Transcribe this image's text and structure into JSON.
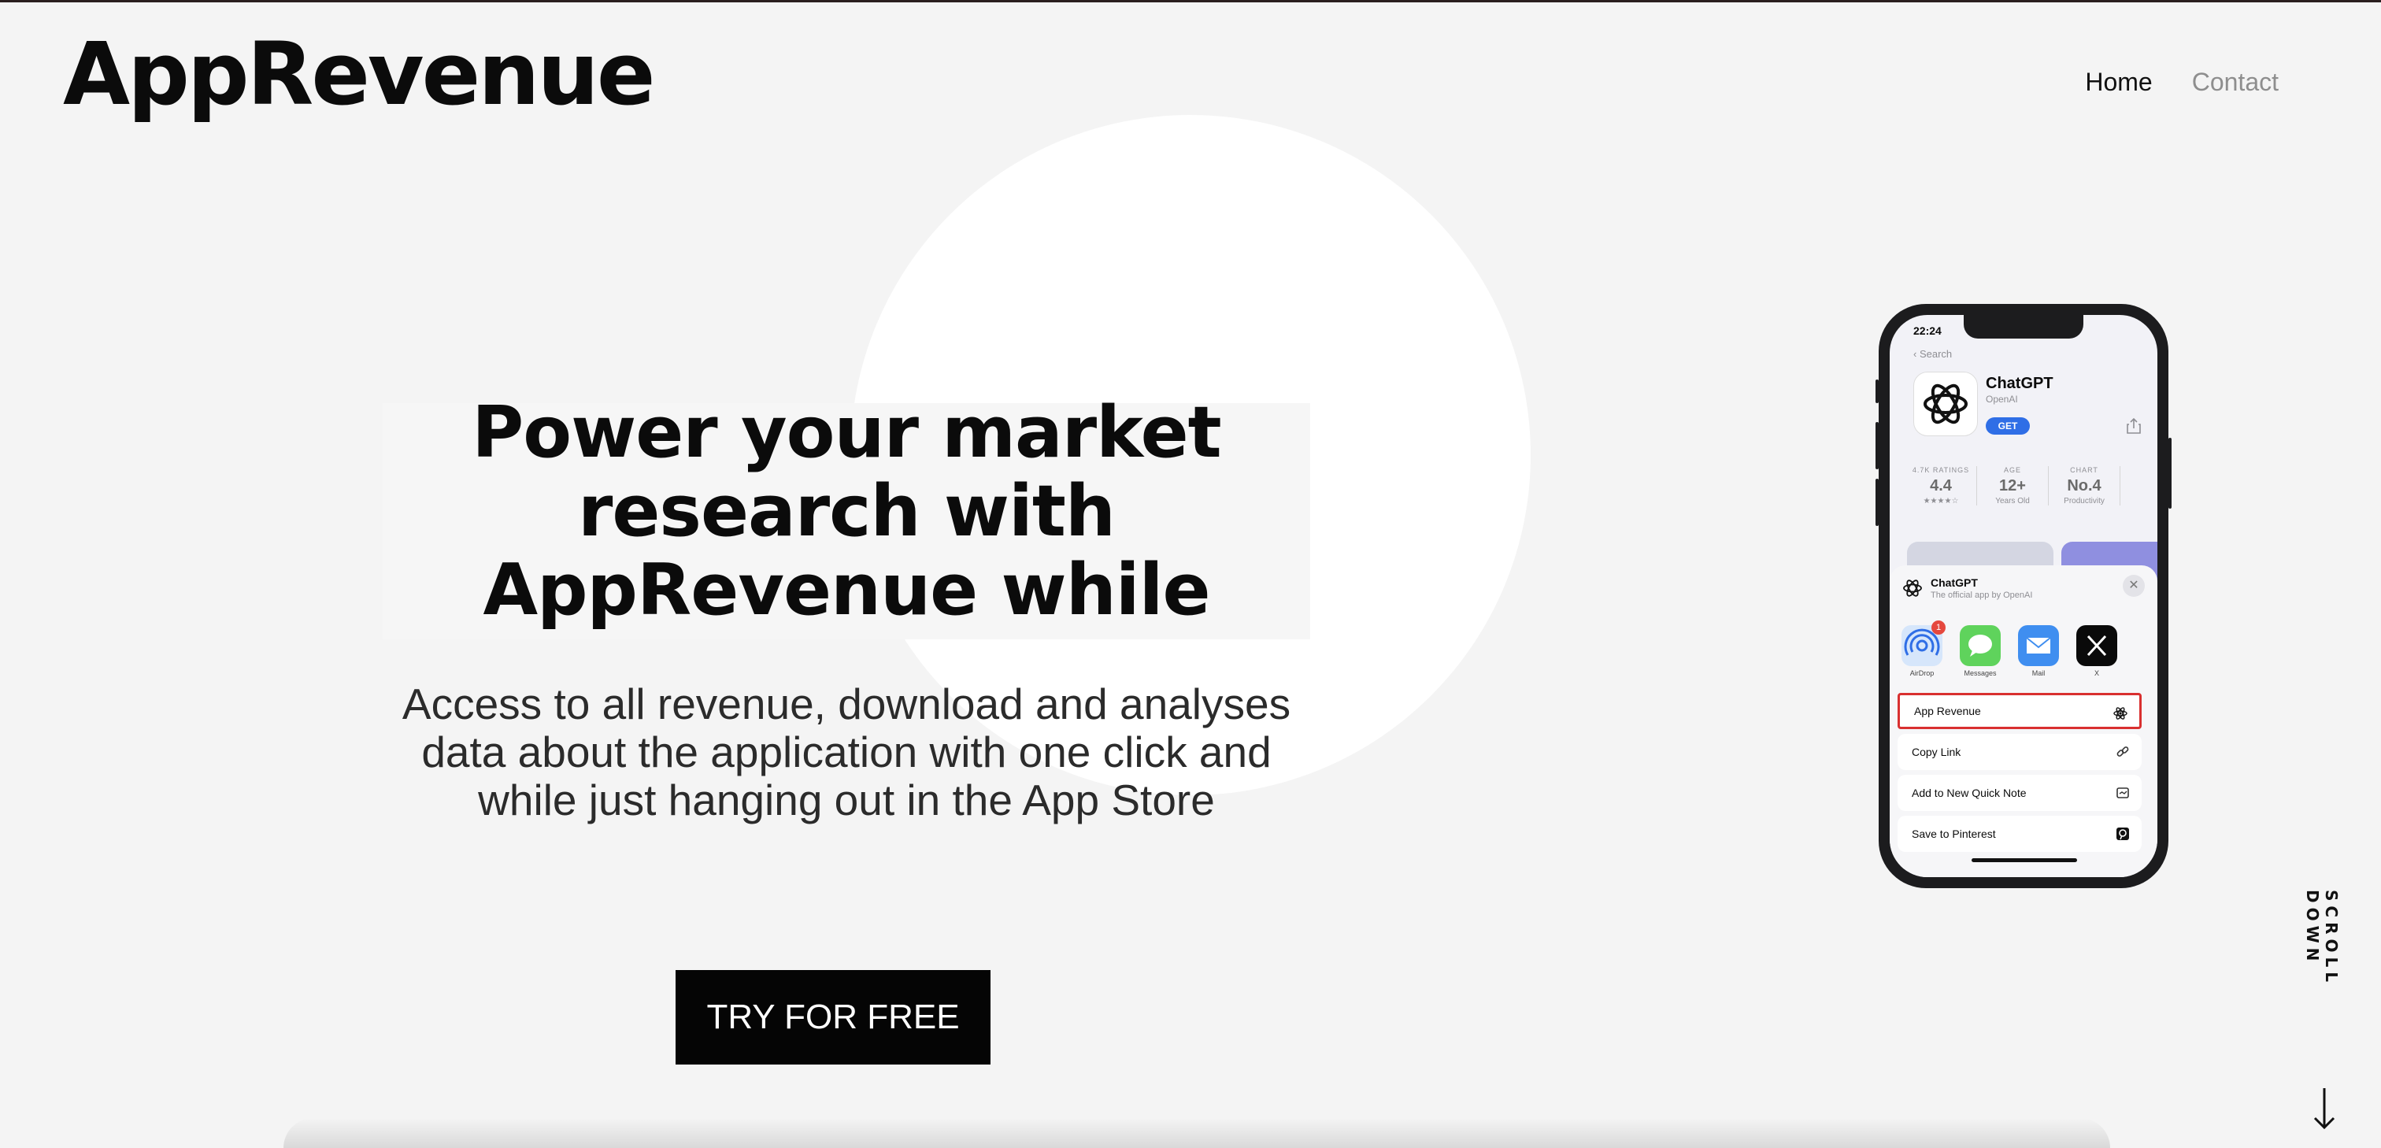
{
  "brand": {
    "logo": "AppRevenue"
  },
  "nav": {
    "items": [
      "Home",
      "Contact"
    ]
  },
  "hero": {
    "headline": "Power your market research with AppRevenue while",
    "subtext": "Access to all revenue, download and analyses data about the application with one click and while just hanging out in the App Store",
    "cta": "TRY FOR FREE"
  },
  "scroll": {
    "label": "SCROLL DOWN",
    "icon": "arrow-down-icon"
  },
  "phone": {
    "status_time": "22:24",
    "back_label": "Search",
    "app": {
      "name": "ChatGPT",
      "developer": "OpenAI",
      "get_label": "GET"
    },
    "stats": [
      {
        "label": "4.7K RATINGS",
        "value": "4.4",
        "sub": "★★★★☆"
      },
      {
        "label": "AGE",
        "value": "12+",
        "sub": "Years Old"
      },
      {
        "label": "CHART",
        "value": "No.4",
        "sub": "Productivity"
      }
    ],
    "sheet": {
      "title": "ChatGPT",
      "subtitle": "The official app by OpenAI",
      "shares": [
        {
          "label": "AirDrop",
          "badge": "1",
          "color": "#d6e6fb",
          "icon": "airdrop-icon"
        },
        {
          "label": "Messages",
          "color": "#5fd35c",
          "icon": "messages-icon"
        },
        {
          "label": "Mail",
          "color": "#3f8ef0",
          "icon": "mail-icon"
        },
        {
          "label": "X",
          "color": "#0a0a0a",
          "icon": "x-icon"
        }
      ],
      "actions": [
        {
          "label": "App Revenue",
          "icon": "atom-icon",
          "highlight": true
        },
        {
          "label": "Copy Link",
          "icon": "link-icon"
        },
        {
          "label": "Add to New Quick Note",
          "icon": "quick-note-icon"
        },
        {
          "label": "Save to Pinterest",
          "icon": "pinterest-icon"
        }
      ]
    }
  },
  "colors": {
    "background": "#f4f4f4",
    "circle": "#ffffff",
    "button": "#050505",
    "highlight": "#d93030",
    "ios_blue": "#2f6ee6"
  }
}
